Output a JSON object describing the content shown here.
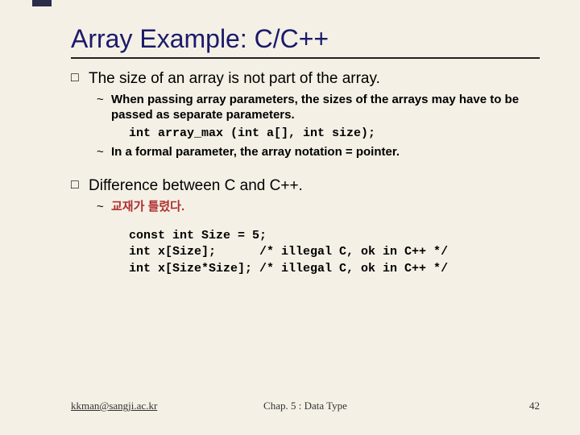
{
  "title": "Array Example: C/C++",
  "bullets": {
    "b1": "The size of an array is not part of the array.",
    "b1a": "When passing array parameters, the sizes of the arrays may have to be passed as separate parameters.",
    "code1": "int array_max (int a[], int size);",
    "b1b": "In a formal parameter, the array notation = pointer.",
    "b2": "Difference between C and C++.",
    "b2a": "교재가 틀렸다.",
    "code2": "const int Size = 5;\nint x[Size];      /* illegal C, ok in C++ */\nint x[Size*Size]; /* illegal C, ok in C++ */"
  },
  "footer": {
    "email": "kkman@sangji.ac.kr",
    "chapter": "Chap. 5 : Data Type",
    "page": "42"
  }
}
